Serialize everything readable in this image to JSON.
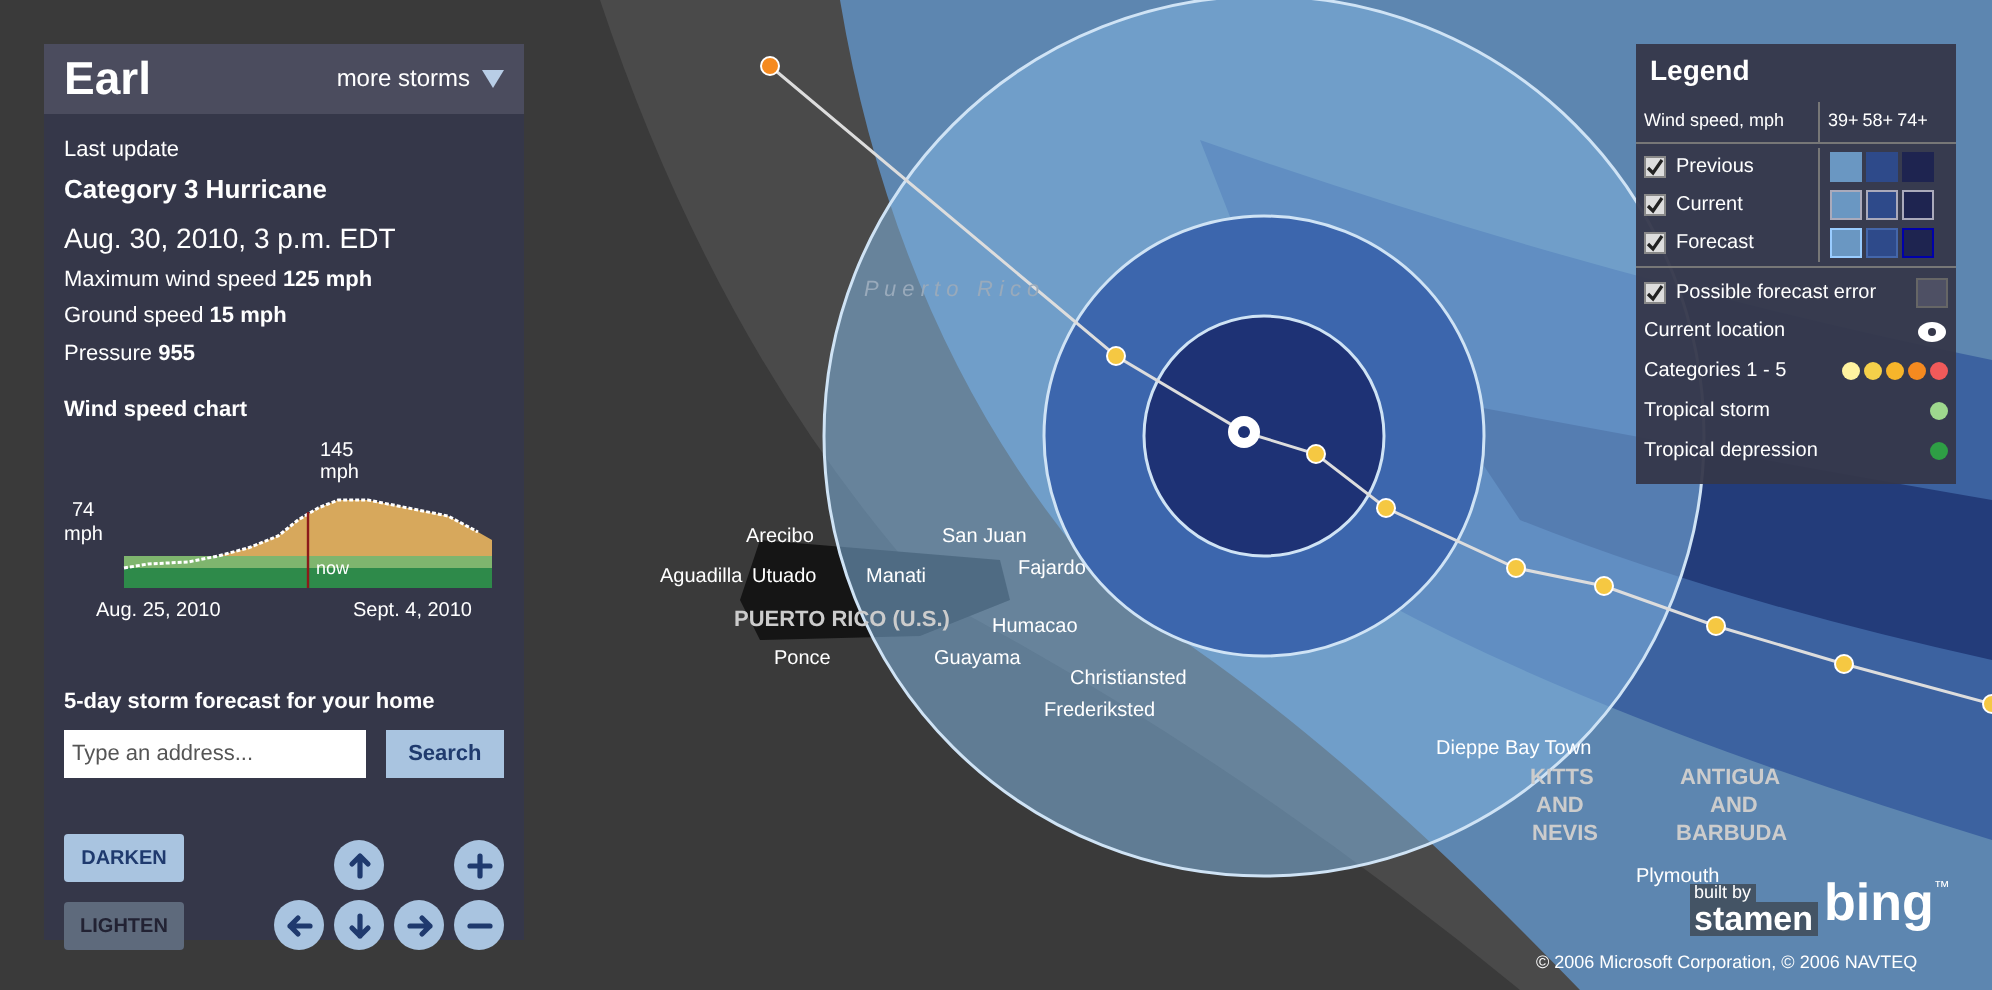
{
  "storm": {
    "name": "Earl",
    "more_storms": "more storms",
    "last_update": "Last update",
    "category": "Category 3 Hurricane",
    "date": "Aug. 30, 2010, 3 p.m. EDT",
    "stats": [
      "Maximum wind speed **125 mph**",
      "Ground speed **15 mph**",
      "Pressure **955**"
    ]
  },
  "chart": {
    "title": "Wind speed chart",
    "start_value": "74",
    "start_unit": "mph",
    "peak_value": "145",
    "peak_unit": "mph",
    "now_label": "now",
    "start_date": "Aug. 25, 2010",
    "end_date": "Sept. 4, 2010"
  },
  "forecast": {
    "title": "5-day storm forecast for your home",
    "placeholder": "Type an address...",
    "button": "Search"
  },
  "map_buttons": [
    {
      "label": "DARKEN",
      "selected": true
    },
    {
      "label": "LIGHTEN",
      "selected": false
    }
  ],
  "legend": {
    "title": "Legend",
    "wind_header": "Wind speed, mph",
    "thresholds": [
      "39+",
      "58+",
      "74+"
    ],
    "rows": [
      {
        "label": "Previous",
        "checked": true,
        "kind": "previous"
      },
      {
        "label": "Current",
        "checked": true,
        "kind": "current"
      },
      {
        "label": "Forecast",
        "checked": true,
        "kind": "forecast"
      }
    ],
    "error": {
      "label": "Possible forecast error",
      "checked": true
    },
    "current_location": "Current location",
    "categories": {
      "label": "Categories 1 - 5",
      "dots": [
        {
          "color": "#fff3a0"
        },
        {
          "color": "#f5d04a"
        },
        {
          "color": "#f7b52a"
        },
        {
          "color": "#f58a1f"
        },
        {
          "color": "#f05a5a"
        }
      ]
    },
    "tropical_storm": {
      "label": "Tropical storm",
      "color": "#9ed88e"
    },
    "tropical_depression": {
      "label": "Tropical depression",
      "color": "#2e9e45"
    }
  },
  "map_labels": [
    {
      "text": "P u e r t o   R i c o",
      "kind": "sea"
    },
    {
      "text": "Arecibo",
      "kind": "city"
    },
    {
      "text": "San Juan",
      "kind": "city"
    },
    {
      "text": "Fajardo",
      "kind": "city"
    },
    {
      "text": "Aguadilla",
      "kind": "city"
    },
    {
      "text": "Utuado",
      "kind": "city"
    },
    {
      "text": "Manati",
      "kind": "city"
    },
    {
      "text": "PUERTO RICO (U.S.)",
      "kind": "country"
    },
    {
      "text": "Humacao",
      "kind": "city"
    },
    {
      "text": "Ponce",
      "kind": "city"
    },
    {
      "text": "Guayama",
      "kind": "city"
    },
    {
      "text": "Christiansted",
      "kind": "city"
    },
    {
      "text": "Frederiksted",
      "kind": "city"
    },
    {
      "text": "Dieppe Bay Town",
      "kind": "city"
    },
    {
      "text": "KITTS",
      "kind": "country"
    },
    {
      "text": "ANTIGUA",
      "kind": "country"
    },
    {
      "text": "AND",
      "kind": "country"
    },
    {
      "text": "AND",
      "kind": "country"
    },
    {
      "text": "NEVIS",
      "kind": "country"
    },
    {
      "text": "BARBUDA",
      "kind": "country"
    },
    {
      "text": "Plymouth",
      "kind": "city"
    }
  ],
  "attribution": {
    "built_by": "built by",
    "stamen": "stamen",
    "bing": "bing",
    "tm": "™",
    "copyright": "© 2006 Microsoft Corporation, © 2006 NAVTEQ"
  }
}
